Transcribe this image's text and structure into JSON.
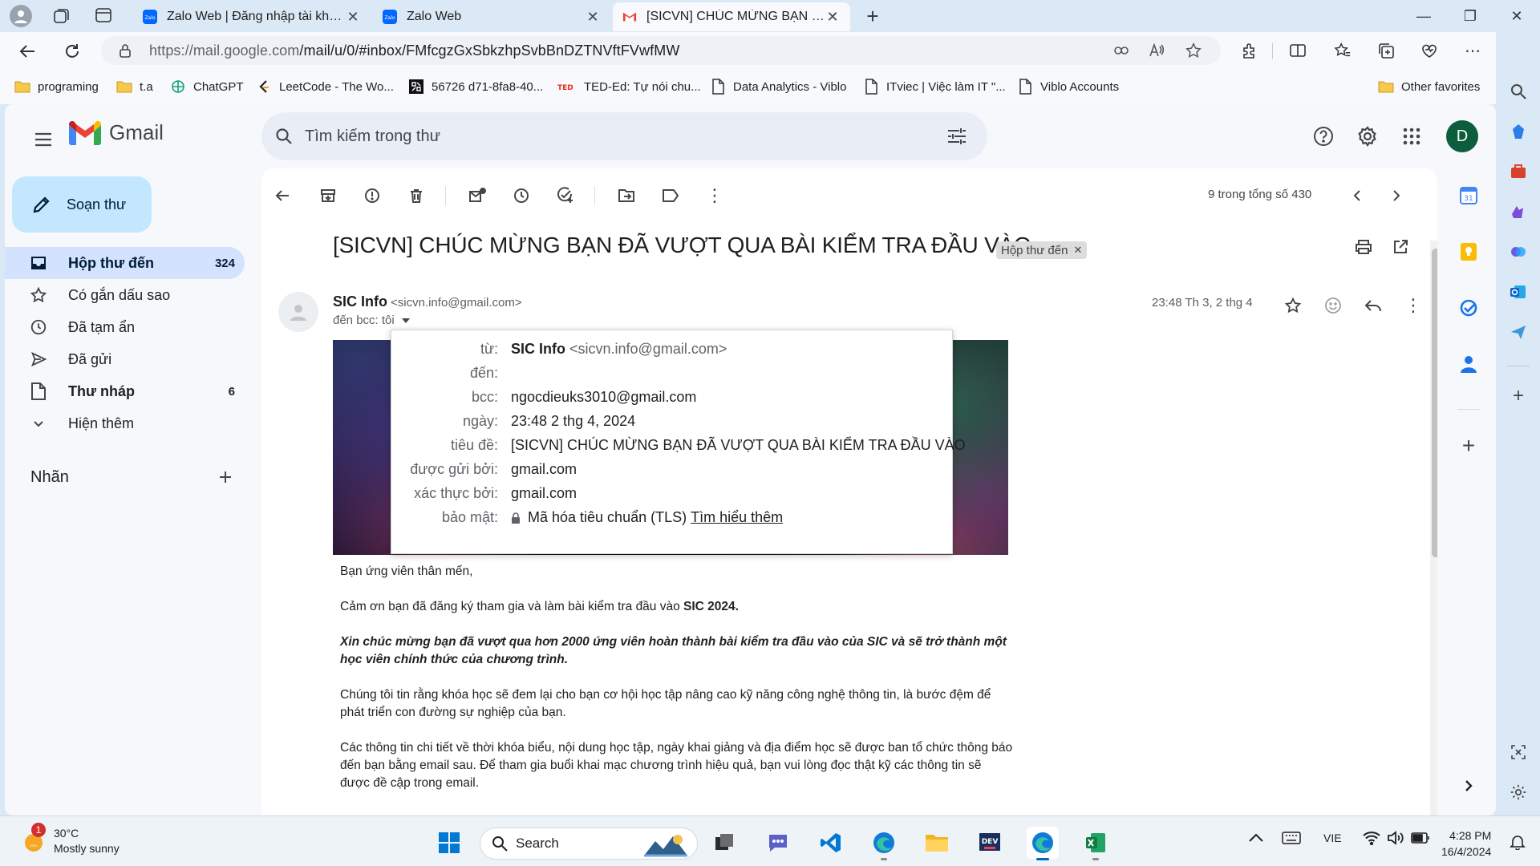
{
  "browser": {
    "tabs": [
      {
        "title": "Zalo Web | Đăng nhập tài khoản",
        "active": false
      },
      {
        "title": "Zalo Web",
        "active": false
      },
      {
        "title": "[SICVN] CHÚC MỪNG BẠN ĐÃ VƯỢT QUA BÀI KIỂM TRA ĐẦU VÀO",
        "active": true
      }
    ],
    "url_host": "https://mail.google.com",
    "url_path": "/mail/u/0/#inbox/FMfcgzGxSbkzhpSvbBnDZTNVftFVwfMW",
    "favorites": [
      {
        "label": "programing",
        "icon": "folder-icon"
      },
      {
        "label": "t.a",
        "icon": "folder-icon"
      },
      {
        "label": "ChatGPT",
        "icon": "chatgpt-icon"
      },
      {
        "label": "LeetCode - The Wo...",
        "icon": "leetcode-icon"
      },
      {
        "label": "56726 d71-8fa8-40...",
        "icon": "page-icon"
      },
      {
        "label": "TED-Ed: Tự nói chu...",
        "icon": "ted-icon"
      },
      {
        "label": "Data Analytics - Viblo",
        "icon": "page-icon"
      },
      {
        "label": "ITviec | Việc làm IT \"...",
        "icon": "page-icon"
      },
      {
        "label": "Viblo Accounts",
        "icon": "page-icon"
      }
    ],
    "other_favorites": "Other favorites"
  },
  "gmail": {
    "logo_text": "Gmail",
    "search_placeholder": "Tìm kiếm trong thư",
    "avatar_letter": "D",
    "compose": "Soạn thư",
    "nav": [
      {
        "label": "Hộp thư đến",
        "count": "324",
        "icon": "inbox-icon"
      },
      {
        "label": "Có gắn dấu sao",
        "count": "",
        "icon": "star-icon"
      },
      {
        "label": "Đã tạm ẩn",
        "count": "",
        "icon": "clock-icon"
      },
      {
        "label": "Đã gửi",
        "count": "",
        "icon": "send-icon"
      },
      {
        "label": "Thư nháp",
        "count": "6",
        "icon": "draft-icon"
      },
      {
        "label": "Hiện thêm",
        "count": "",
        "icon": "chevron-down-icon"
      }
    ],
    "labels_title": "Nhãn",
    "pager": "9 trong tổng số 430",
    "subject": "[SICVN] CHÚC MỪNG BẠN ĐÃ VƯỢT QUA BÀI KIỂM TRA ĐẦU VÀO",
    "label_chip": "Hộp thư đến",
    "sender_name": "SIC Info",
    "sender_email": "<sicvn.info@gmail.com>",
    "to_line": "đến bcc: tôi",
    "date": "23:48 Th 3, 2 thg 4",
    "details": {
      "from_label": "từ:",
      "from_name": "SIC Info",
      "from_email": "<sicvn.info@gmail.com>",
      "to_label": "đến:",
      "to_value": "",
      "bcc_label": "bcc:",
      "bcc_value": "ngocdieuks3010@gmail.com",
      "date_label": "ngày:",
      "date_value": "23:48 2 thg 4, 2024",
      "subject_label": "tiêu đề:",
      "subject_value": "[SICVN] CHÚC MỪNG BẠN ĐÃ VƯỢT QUA BÀI KIỂM TRA ĐẦU VÀO",
      "mailedby_label": "được gửi bởi:",
      "mailedby_value": "gmail.com",
      "signedby_label": "xác thực bởi:",
      "signedby_value": "gmail.com",
      "security_label": "bảo mật:",
      "security_value": "Mã hóa tiêu chuẩn (TLS)",
      "security_link": "Tìm hiểu thêm"
    },
    "body": {
      "greeting": "Bạn ứng viên thân mến,",
      "p1_text": "Cảm ơn bạn đã đăng ký tham gia và làm bài kiểm tra đầu vào ",
      "p1_bold": "SIC 2024.",
      "p2": "Xin chúc mừng bạn đã vượt qua hơn 2000 ứng viên hoàn thành bài kiểm tra đầu vào của SIC và sẽ trở thành một học viên chính thức của chương trình.",
      "p3": "Chúng tôi tin rằng khóa học sẽ đem lại cho bạn cơ hội học tập nâng cao kỹ năng công nghệ thông tin, là bước đệm để phát triển con đường sự nghiệp của bạn.",
      "p4": "Các thông tin chi tiết về thời khóa biểu, nội dung học tập, ngày khai giảng và địa điểm học sẽ được ban tổ chức thông báo đến bạn bằng email sau. Để tham gia buổi khai mạc chương trình hiệu quả, bạn vui lòng đọc thật kỹ các thông tin sẽ được đề cập trong email."
    }
  },
  "taskbar": {
    "weather_badge": "1",
    "temperature": "30°C",
    "weather": "Mostly sunny",
    "search": "Search",
    "language": "VIE",
    "time": "4:28 PM",
    "date": "16/4/2024"
  }
}
